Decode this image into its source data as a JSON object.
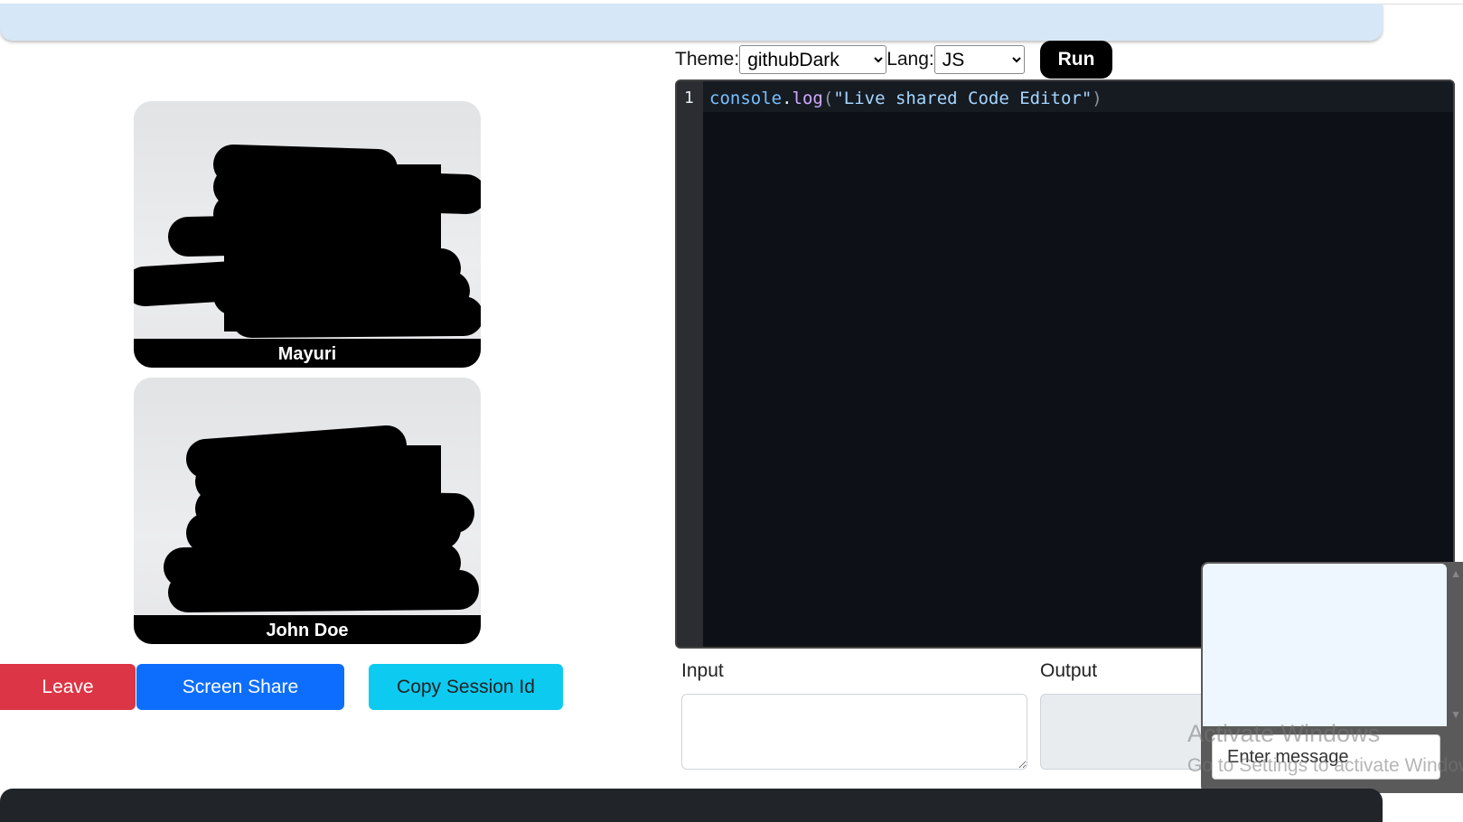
{
  "participants": [
    {
      "name": "Mayuri"
    },
    {
      "name": "John Doe"
    }
  ],
  "controls": {
    "leave_label": "Leave",
    "screen_share_label": "Screen Share",
    "copy_session_label": "Copy Session Id"
  },
  "toolbar": {
    "theme_label": "Theme:",
    "theme_value": "githubDark",
    "lang_label": "Lang:",
    "lang_value": "JS",
    "run_label": "Run"
  },
  "editor": {
    "line_number": "1",
    "code_object": "console",
    "code_dot": ".",
    "code_function": "log",
    "code_open_paren": "(",
    "code_string": "\"Live shared Code Editor\"",
    "code_close_paren": ")"
  },
  "io": {
    "input_label": "Input",
    "output_label": "Output"
  },
  "chat": {
    "placeholder": "Enter message"
  },
  "watermark": {
    "line1": "Activate Windows",
    "line2": "Go to Settings to activate Windows."
  },
  "colors": {
    "leave": "#dc3545",
    "screen_share": "#0d6efd",
    "copy_session": "#0dcaf0",
    "editor_bg": "#0d1117",
    "top_bar": "#d6e7f7",
    "footer": "#212529"
  }
}
